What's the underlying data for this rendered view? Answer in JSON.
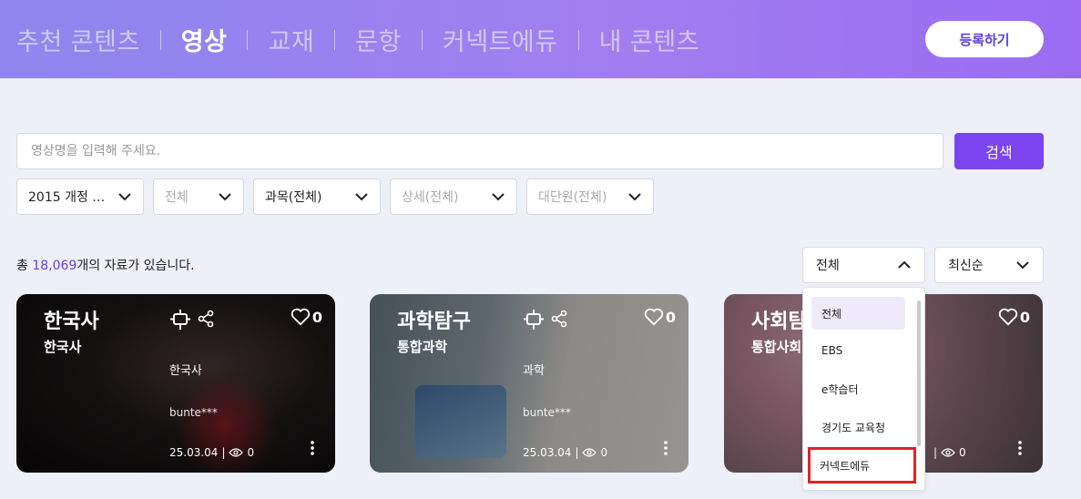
{
  "header": {
    "nav": [
      {
        "label": "추천 콘텐츠",
        "active": false
      },
      {
        "label": "영상",
        "active": true
      },
      {
        "label": "교재",
        "active": false
      },
      {
        "label": "문항",
        "active": false
      },
      {
        "label": "커넥트에듀",
        "active": false
      },
      {
        "label": "내 콘텐츠",
        "active": false
      }
    ],
    "register_label": "등록하기"
  },
  "search": {
    "placeholder": "영상명을 입력해 주세요.",
    "value": "",
    "button_label": "검색"
  },
  "filters": [
    {
      "label": "2015 개정 …",
      "dim": false
    },
    {
      "label": "전체",
      "dim": true
    },
    {
      "label": "과목(전체)",
      "dim": false
    },
    {
      "label": "상세(전체)",
      "dim": true
    },
    {
      "label": "대단원(전체)",
      "dim": true
    }
  ],
  "results": {
    "prefix": "총 ",
    "count": "18,069",
    "suffix": "개의 자료가 있습니다."
  },
  "sort": {
    "source_selected": "전체",
    "order_selected": "최신순"
  },
  "source_menu": {
    "items": [
      "전체",
      "EBS",
      "e학습터",
      "경기도 교육청",
      "커넥트에듀"
    ],
    "selected_index": 0,
    "highlighted_index": 4
  },
  "cards": [
    {
      "title": "한국사",
      "subject": "한국사",
      "tag": "한국사",
      "author": "bunte***",
      "date": "25.03.04",
      "views": "0",
      "likes": "0"
    },
    {
      "title": "과학탐구",
      "subject": "통합과학",
      "tag": "과학",
      "author": "bunte***",
      "date": "25.03.04",
      "views": "0",
      "likes": "0"
    },
    {
      "title": "사회탐",
      "subject": "통합사회",
      "tag": "",
      "author": "",
      "date": "",
      "views": "0",
      "likes": "0"
    }
  ],
  "colors": {
    "accent": "#7a45ef",
    "count": "#6b3ce8",
    "highlight_box": "#e32127"
  }
}
